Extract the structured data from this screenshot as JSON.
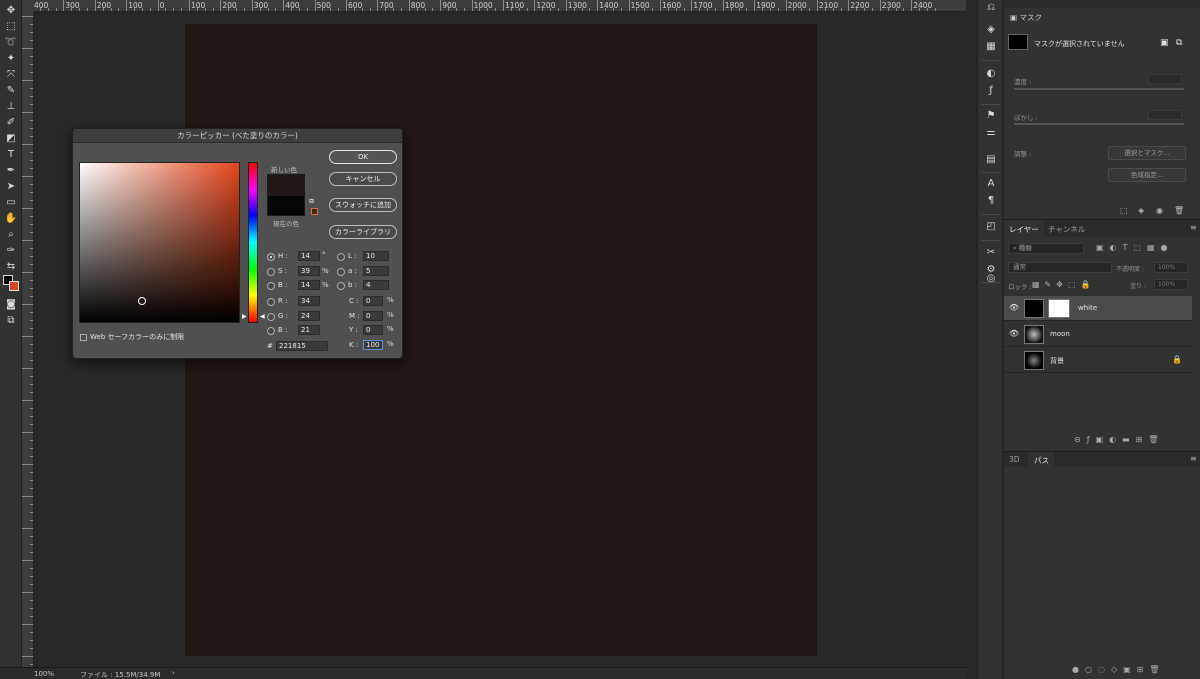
{
  "ruler": {
    "ticks": [
      "400",
      "300",
      "200",
      "100",
      "0",
      "100",
      "200",
      "300",
      "400",
      "500",
      "600",
      "700",
      "800",
      "900",
      "1000",
      "1100",
      "1200",
      "1300",
      "1400",
      "1500",
      "1600",
      "1700",
      "1800",
      "1900",
      "2000",
      "2100",
      "2200",
      "2300",
      "2400"
    ]
  },
  "toolbar": {
    "icons": [
      "move-icon",
      "marquee-icon",
      "lasso-icon",
      "magic-wand-icon",
      "eyedropper-sample-icon",
      "brush-icon",
      "stamp-icon",
      "history-brush-icon",
      "eraser-icon",
      "gradient-icon",
      "pen-icon",
      "text-icon",
      "path-select-icon",
      "rectangle-icon",
      "hand-icon",
      "zoom-icon",
      "eyedropper-icon",
      "swap-colors-icon"
    ]
  },
  "status": {
    "zoom": "100%",
    "file": "ファイル : 15.5M/34.9M",
    "arrow": "›"
  },
  "properties": {
    "mask_tab": "マスク",
    "mask_message": "マスクが選択されていません",
    "density_label": "濃度 :",
    "feather_label": "ぼかし :",
    "refine_label": "調整 :",
    "select_mask_button": "選択とマスク...",
    "color_range_button": "色域指定..."
  },
  "layers_panel": {
    "tab_layers": "レイヤー",
    "tab_channels": "チャンネル",
    "filter_placeholder": "種類",
    "blend_mode": "通常",
    "opacity_label": "不透明度 :",
    "opacity_value": "100%",
    "lock_label": "ロック :",
    "fill_label": "塗り :",
    "fill_value": "100%",
    "layers": [
      {
        "name": "white",
        "visible": true,
        "selected": true,
        "has_mask": true
      },
      {
        "name": "moon",
        "visible": true,
        "selected": false,
        "has_mask": false
      },
      {
        "name": "背景",
        "visible": false,
        "selected": false,
        "has_mask": false,
        "locked": true
      }
    ]
  },
  "paths_panel": {
    "tab_3d": "3D",
    "tab_paths": "パス"
  },
  "color_picker": {
    "title": "カラーピッカー (べた塗りのカラー)",
    "new_label": "新しい色",
    "current_label": "現在の色",
    "new_color": "#221815",
    "current_color": "#070606",
    "buttons": {
      "ok": "OK",
      "cancel": "キャンセル",
      "add_swatch": "スウォッチに追加",
      "color_libraries": "カラーライブラリ"
    },
    "hsb": {
      "h_label": "H :",
      "h_value": "14",
      "h_unit": "°",
      "s_label": "S :",
      "s_value": "39",
      "s_unit": "%",
      "b_label": "B :",
      "b_value": "14",
      "b_unit": "%"
    },
    "lab": {
      "l_label": "L :",
      "l_value": "10",
      "a_label": "a :",
      "a_value": "5",
      "b_label": "b :",
      "b_value": "4"
    },
    "rgb": {
      "r_label": "R :",
      "r_value": "34",
      "g_label": "G :",
      "g_value": "24",
      "b_label": "B :",
      "b_value": "21"
    },
    "cmyk": {
      "c_label": "C :",
      "c_value": "0",
      "c_unit": "%",
      "m_label": "M :",
      "m_value": "0",
      "m_unit": "%",
      "y_label": "Y :",
      "y_value": "0",
      "y_unit": "%",
      "k_label": "K :",
      "k_value": "100",
      "k_unit": "%"
    },
    "hex_label": "#",
    "hex_value": "221815",
    "web_only_label": "Web セーフカラーのみに制限"
  }
}
